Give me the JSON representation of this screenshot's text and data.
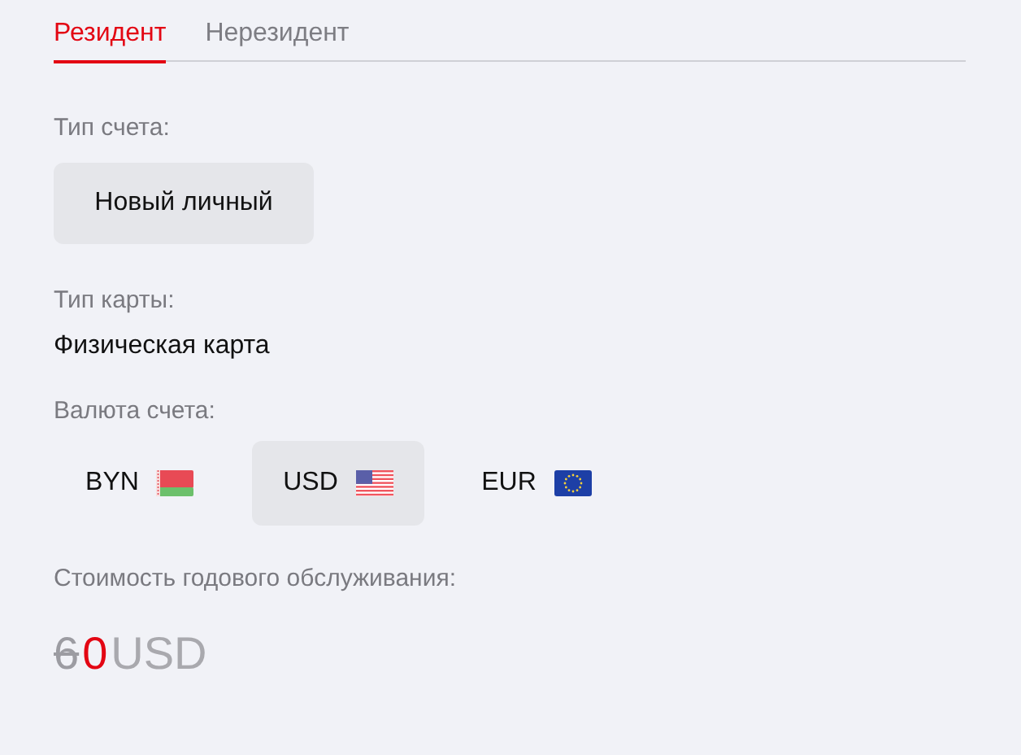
{
  "tabs": [
    {
      "label": "Резидент",
      "selected": true
    },
    {
      "label": "Нерезидент",
      "selected": false
    }
  ],
  "account_type": {
    "label": "Тип счета:",
    "options": [
      {
        "label": "Новый личный",
        "selected": true
      }
    ]
  },
  "card_type": {
    "label": "Тип карты:",
    "value": "Физическая карта"
  },
  "currency": {
    "label": "Валюта счета:",
    "options": [
      {
        "label": "BYN",
        "kind": "by",
        "selected": false
      },
      {
        "label": "USD",
        "kind": "us",
        "selected": true
      },
      {
        "label": "EUR",
        "kind": "eu",
        "selected": false
      }
    ]
  },
  "annual_fee": {
    "label": "Стоимость годового обслуживания:",
    "old_price": "6",
    "new_price": "0",
    "currency": "USD"
  }
}
